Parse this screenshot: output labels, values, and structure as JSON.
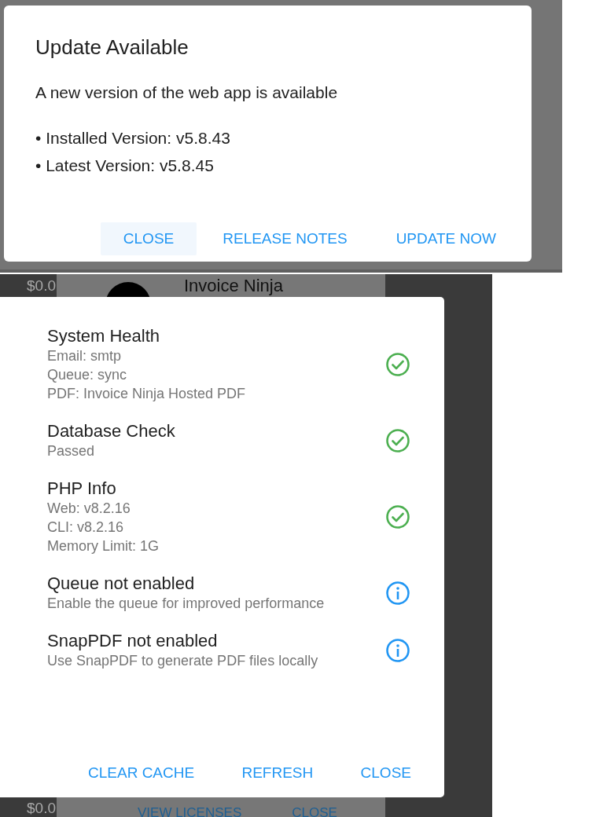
{
  "update_dialog": {
    "title": "Update Available",
    "message": "A new version of the web app is available",
    "bullets": [
      "• Installed Version: v5.8.43",
      "• Latest Version: v5.8.45"
    ],
    "buttons": [
      {
        "label": "CLOSE",
        "focused": true
      },
      {
        "label": "RELEASE NOTES",
        "focused": false
      },
      {
        "label": "UPDATE NOW",
        "focused": false
      }
    ]
  },
  "background": {
    "amount_top": "$0.0",
    "app_name": "Invoice Ninja",
    "amount_bottom": "$0.0",
    "buttons": [
      "VIEW LICENSES",
      "CLOSE"
    ]
  },
  "health_dialog": {
    "items": [
      {
        "title": "System Health",
        "details": [
          "Email: smtp",
          "Queue: sync",
          "PDF: Invoice Ninja Hosted PDF"
        ],
        "kind": "ok"
      },
      {
        "title": "Database Check",
        "details": [
          "Passed"
        ],
        "kind": "ok"
      },
      {
        "title": "PHP Info",
        "details": [
          "Web: v8.2.16",
          "CLI: v8.2.16",
          "Memory Limit: 1G"
        ],
        "kind": "ok"
      },
      {
        "title": "Queue not enabled",
        "details": [
          "Enable the queue for improved performance"
        ],
        "kind": "info"
      },
      {
        "title": "SnapPDF not enabled",
        "details": [
          "Use SnapPDF to generate PDF files locally"
        ],
        "kind": "info"
      }
    ],
    "buttons": [
      "CLEAR CACHE",
      "REFRESH",
      "CLOSE"
    ]
  }
}
